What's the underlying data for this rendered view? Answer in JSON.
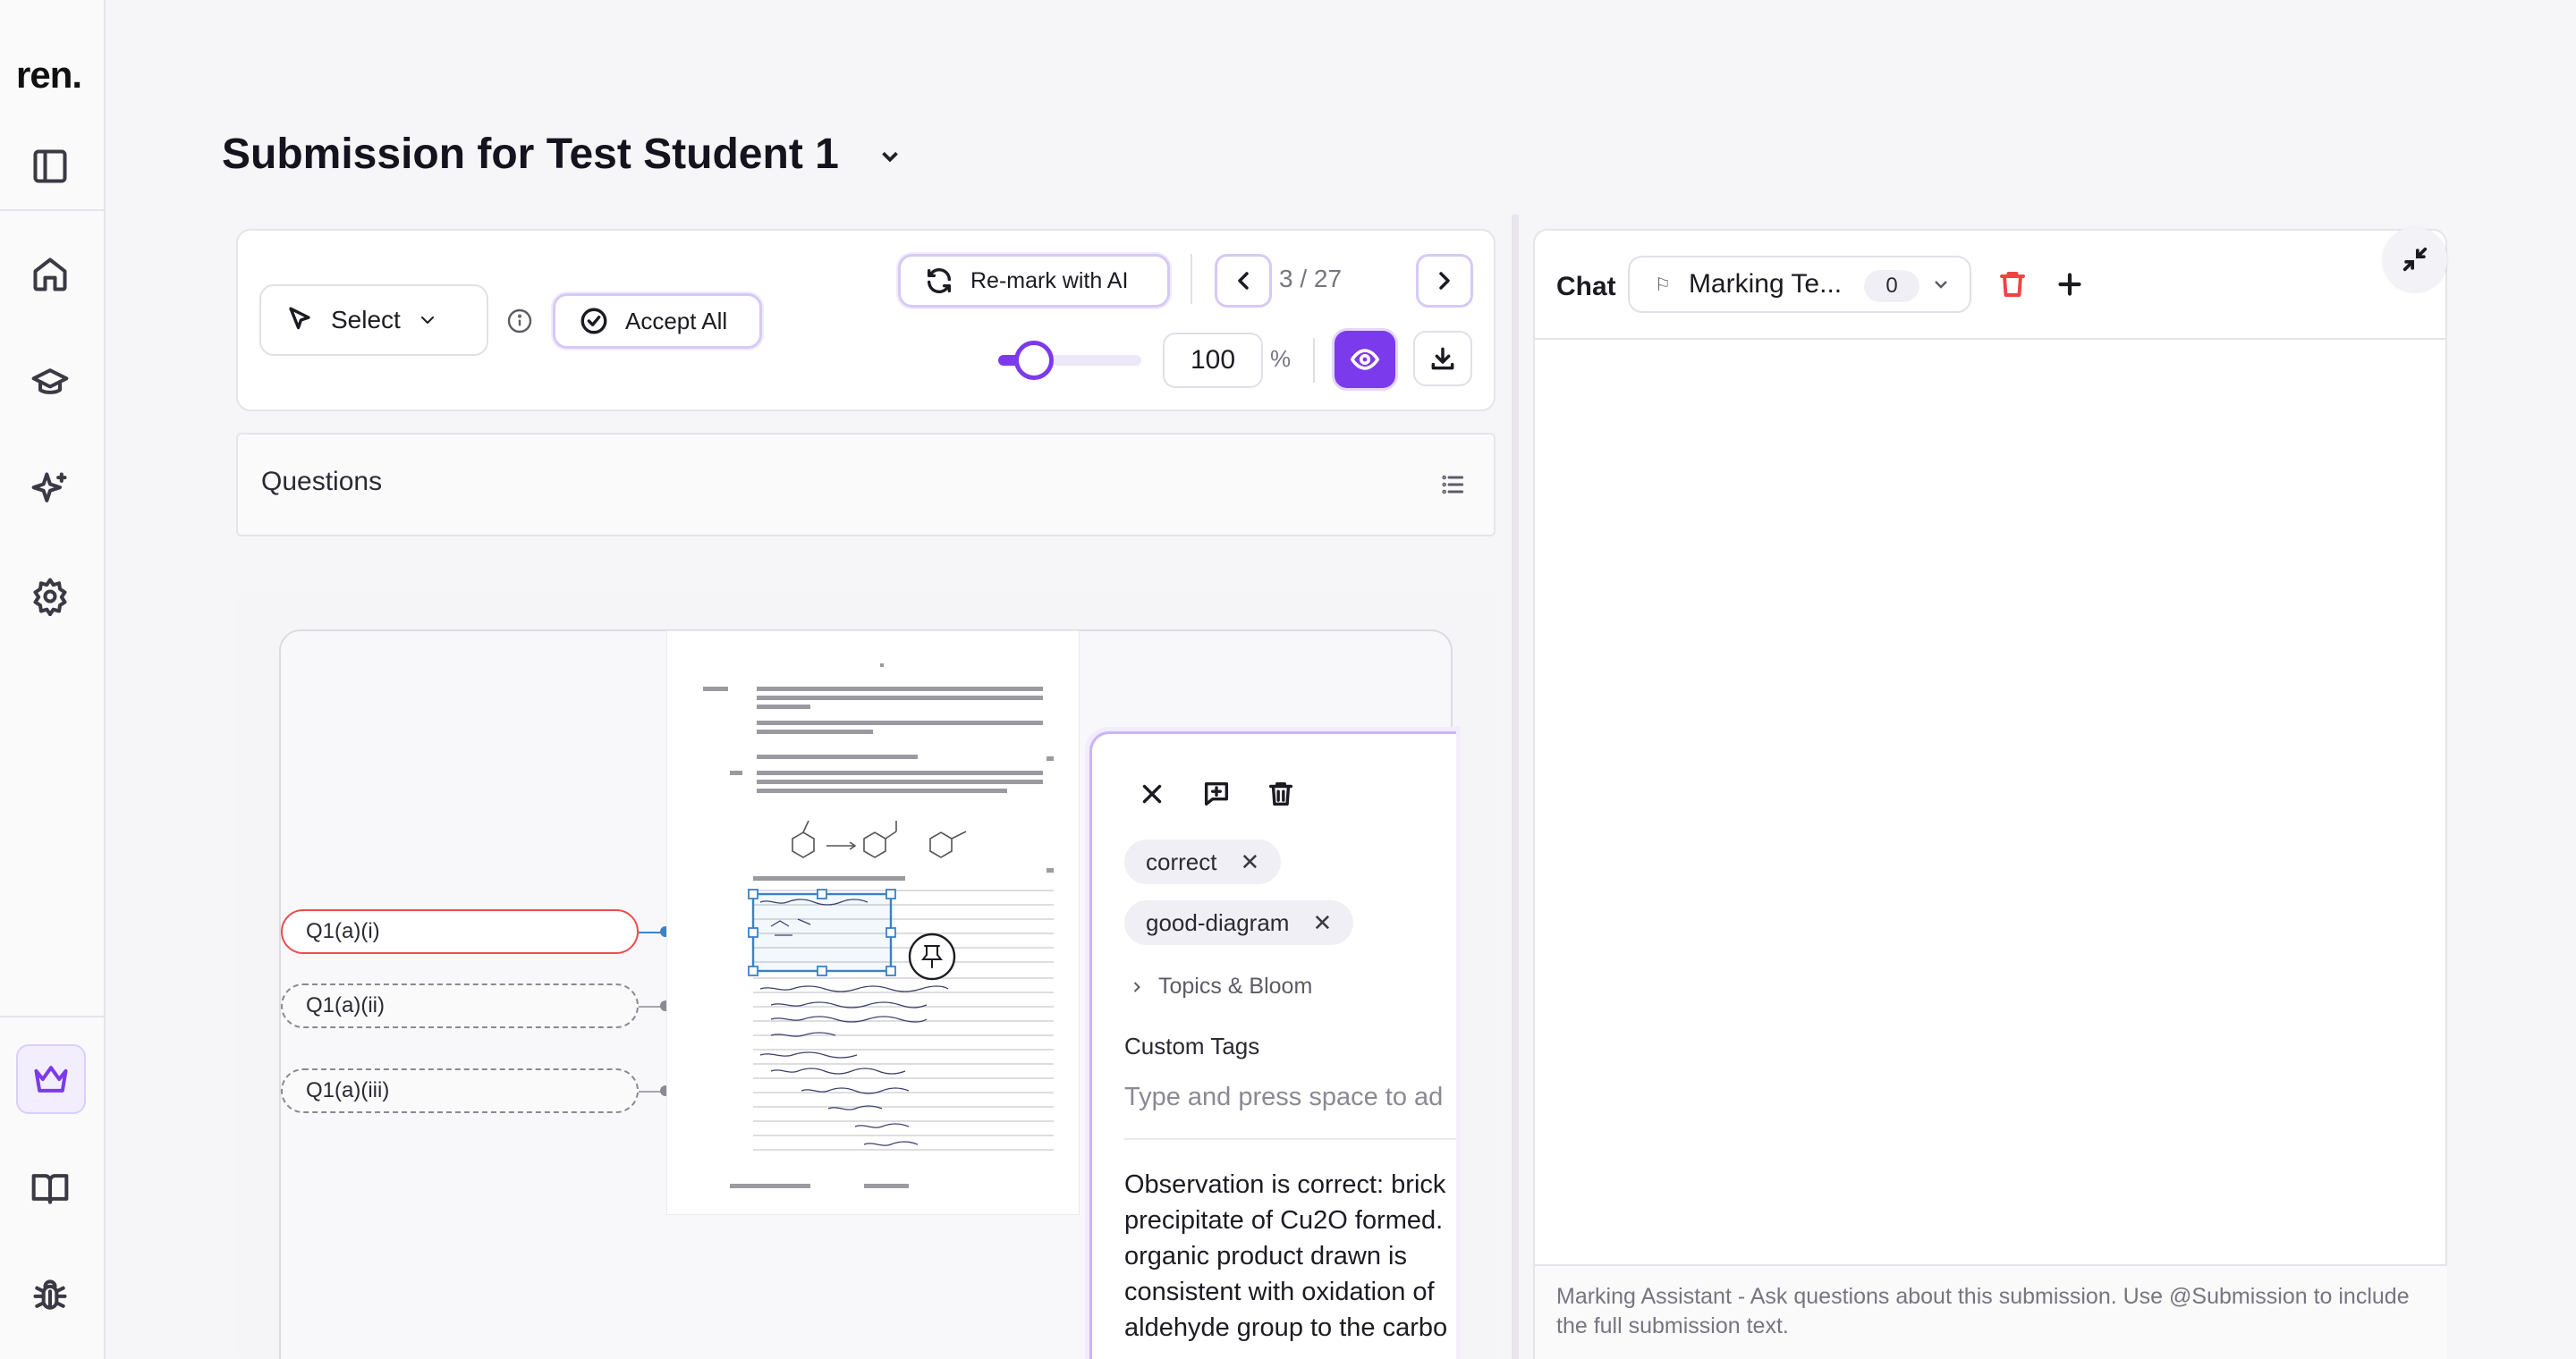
{
  "app": {
    "logo": "ren."
  },
  "header": {
    "title": "Submission for Test Student 1"
  },
  "toolbar": {
    "select_label": "Select",
    "accept_all_label": "Accept All",
    "remark_label": "Re-mark with AI",
    "page_indicator": "3 / 27",
    "zoom_value": "100",
    "zoom_unit": "%",
    "zoom_fraction": 0.25,
    "accent_color": "#7c3aed"
  },
  "questions": {
    "label": "Questions"
  },
  "question_pills": [
    {
      "label": "Q1(a)(i)",
      "active": true
    },
    {
      "label": "Q1(a)(ii)",
      "active": false
    },
    {
      "label": "Q1(a)(iii)",
      "active": false
    }
  ],
  "annotation": {
    "tags": [
      {
        "label": "correct",
        "remove": "✕"
      },
      {
        "label": "good-diagram",
        "remove": "✕"
      }
    ],
    "topics_label": "Topics & Bloom",
    "custom_tags_label": "Custom Tags",
    "custom_tags_placeholder": "Type and press space to ad",
    "comment_lines": [
      "Observation is correct: brick",
      "precipitate of Cu2O formed.",
      "organic product drawn is",
      "consistent with oxidation of",
      "aldehyde group to the carbo"
    ]
  },
  "chat": {
    "title": "Chat",
    "session_label": "Marking Te...",
    "session_count": "0",
    "hint": "Marking Assistant - Ask questions about this submission. Use @Submission to include the full submission text."
  }
}
